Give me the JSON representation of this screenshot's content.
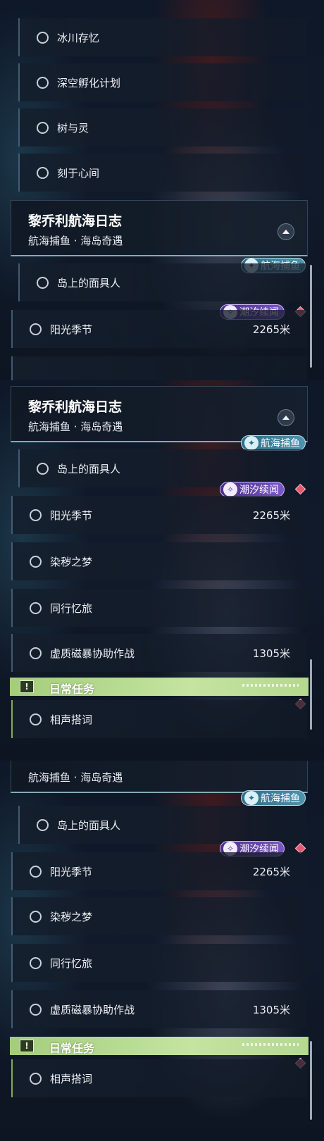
{
  "panel1": {
    "items_top": [
      "冰川存忆",
      "深空孵化计划",
      "树与灵",
      "刻于心间"
    ],
    "header": {
      "title": "黎乔利航海日志",
      "subtitle": "航海捕鱼 · 海岛奇遇"
    },
    "tag_fishing": "航海捕鱼",
    "row1": {
      "label": "岛上的面具人"
    },
    "tag_tide": "潮汐续闻",
    "row2": {
      "label": "阳光季节",
      "distance": "2265米"
    }
  },
  "panel2": {
    "header": {
      "title": "黎乔利航海日志",
      "subtitle": "航海捕鱼 · 海岛奇遇"
    },
    "tag_fishing": "航海捕鱼",
    "row1": {
      "label": "岛上的面具人"
    },
    "tag_tide": "潮汐续闻",
    "row2": {
      "label": "阳光季节",
      "distance": "2265米"
    },
    "row3": {
      "label": "染秽之梦"
    },
    "row4": {
      "label": "同行忆旅"
    },
    "row5": {
      "label": "虚质磁暴协助作战",
      "distance": "1305米"
    },
    "daily": {
      "label": "日常任务"
    },
    "row6": {
      "label": "相声搭词"
    }
  },
  "panel3": {
    "header": {
      "subtitle": "航海捕鱼 · 海岛奇遇"
    },
    "tag_fishing": "航海捕鱼",
    "row1": {
      "label": "岛上的面具人"
    },
    "tag_tide": "潮汐续闻",
    "row2": {
      "label": "阳光季节",
      "distance": "2265米"
    },
    "row3": {
      "label": "染秽之梦"
    },
    "row4": {
      "label": "同行忆旅"
    },
    "row5": {
      "label": "虚质磁暴协助作战",
      "distance": "1305米"
    },
    "daily": {
      "label": "日常任务"
    },
    "row6": {
      "label": "相声搭词"
    }
  },
  "icons": {
    "quest_status": "circle-outline-icon",
    "collapse": "chevron-up-icon",
    "fishing_tag": "fish-icon",
    "tide_tag": "sparkle-icon",
    "daily": "exclamation-icon",
    "marker": "diamond-marker-icon"
  },
  "colors": {
    "fishing_tag": "#3f86a1",
    "tide_tag": "#6a48b4",
    "daily_bar": "#b5d88f",
    "marker": "#e05a70"
  }
}
